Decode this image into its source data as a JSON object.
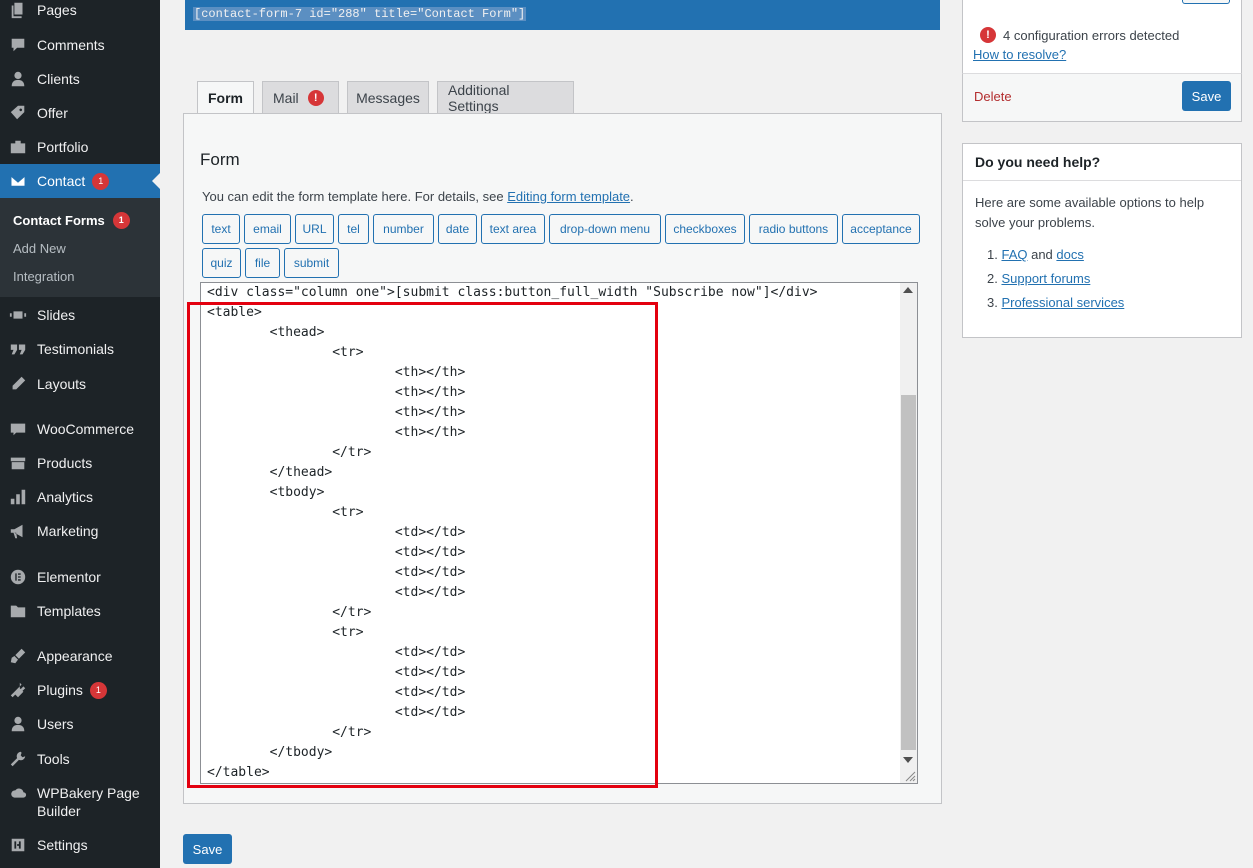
{
  "sidebar": {
    "items": [
      {
        "label": "Pages",
        "icon": "pages-icon"
      },
      {
        "label": "Comments",
        "icon": "comments-icon"
      },
      {
        "label": "Clients",
        "icon": "clients-icon"
      },
      {
        "label": "Offer",
        "icon": "offer-icon"
      },
      {
        "label": "Portfolio",
        "icon": "portfolio-icon"
      },
      {
        "label": "Contact",
        "icon": "mail-icon",
        "badge": "1"
      },
      {
        "label": "Slides",
        "icon": "slides-icon"
      },
      {
        "label": "Testimonials",
        "icon": "quote-icon"
      },
      {
        "label": "Layouts",
        "icon": "layouts-icon"
      },
      {
        "label": "WooCommerce",
        "icon": "woocommerce-icon"
      },
      {
        "label": "Products",
        "icon": "products-icon"
      },
      {
        "label": "Analytics",
        "icon": "analytics-icon"
      },
      {
        "label": "Marketing",
        "icon": "marketing-icon"
      },
      {
        "label": "Elementor",
        "icon": "elementor-icon"
      },
      {
        "label": "Templates",
        "icon": "templates-icon"
      },
      {
        "label": "Appearance",
        "icon": "appearance-icon"
      },
      {
        "label": "Plugins",
        "icon": "plugins-icon",
        "badge": "1"
      },
      {
        "label": "Users",
        "icon": "users-icon"
      },
      {
        "label": "Tools",
        "icon": "tools-icon"
      },
      {
        "label": "WPBakery Page",
        "label2": "Builder",
        "icon": "wpbakery-icon"
      },
      {
        "label": "Settings",
        "icon": "settings-icon"
      }
    ],
    "submenu": [
      {
        "label": "Contact Forms",
        "badge": "1"
      },
      {
        "label": "Add New"
      },
      {
        "label": "Integration"
      }
    ]
  },
  "shortcode": "[contact-form-7 id=\"288\" title=\"Contact Form\"]",
  "tabs": [
    {
      "label": "Form"
    },
    {
      "label": "Mail",
      "alert": "!"
    },
    {
      "label": "Messages"
    },
    {
      "label": "Additional Settings"
    }
  ],
  "form": {
    "heading": "Form",
    "desc_prefix": "You can edit the form template here. For details, see ",
    "desc_link": "Editing form template",
    "desc_suffix": ".",
    "tag_buttons_row1": [
      "text",
      "email",
      "URL",
      "tel",
      "number",
      "date",
      "text area",
      "drop-down menu",
      "checkboxes",
      "radio buttons",
      "acceptance"
    ],
    "tag_buttons_row2": [
      "quiz",
      "file",
      "submit"
    ],
    "code_lines": [
      "<div class=\"column one\">[submit class:button_full_width \"Subscribe now\"]</div>",
      "<table>",
      "        <thead>",
      "                <tr>",
      "                        <th></th>",
      "                        <th></th>",
      "                        <th></th>",
      "                        <th></th>",
      "                </tr>",
      "        </thead>",
      "        <tbody>",
      "                <tr>",
      "                        <td></td>",
      "                        <td></td>",
      "                        <td></td>",
      "                        <td></td>",
      "                </tr>",
      "                <tr>",
      "                        <td></td>",
      "                        <td></td>",
      "                        <td></td>",
      "                        <td></td>",
      "                </tr>",
      "        </tbody>",
      "</table>"
    ],
    "save_label": "Save"
  },
  "status_box": {
    "errors_text": "4 configuration errors detected",
    "errors_icon": "!",
    "resolve_link": "How to resolve?",
    "delete_label": "Delete",
    "save_label": "Save"
  },
  "help_box": {
    "title": "Do you need help?",
    "text": "Here are some available options to help solve your problems.",
    "item1_faq": "FAQ",
    "item1_and": " and ",
    "item1_docs": "docs",
    "item2": "Support forums",
    "item3": "Professional services"
  },
  "colors": {
    "accent": "#2271b1",
    "sidebar_bg": "#1d2327",
    "highlight": "#e3000f",
    "error": "#d63638"
  }
}
